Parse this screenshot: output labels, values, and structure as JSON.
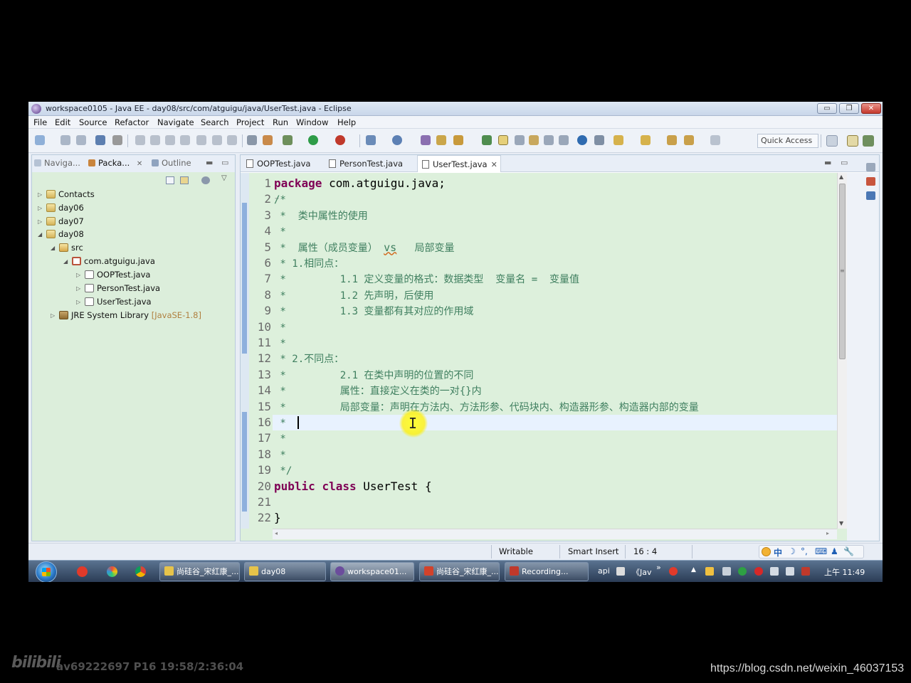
{
  "window": {
    "title": "workspace0105 - Java EE - day08/src/com/atguigu/java/UserTest.java - Eclipse",
    "controls": [
      "▭",
      "❐",
      "✕"
    ]
  },
  "menu": [
    "File",
    "Edit",
    "Source",
    "Refactor",
    "Navigate",
    "Search",
    "Project",
    "Run",
    "Window",
    "Help"
  ],
  "toolbar": {
    "quick_access": "Quick Access"
  },
  "left_panel": {
    "tabs": [
      {
        "label": "Naviga...",
        "active": false
      },
      {
        "label": "Packa...",
        "active": true,
        "close": "✕"
      },
      {
        "label": "Outline",
        "active": false
      }
    ],
    "tree": [
      {
        "label": "Contacts",
        "depth": 0,
        "arrow": "▷",
        "icon": "project-icon"
      },
      {
        "label": "day06",
        "depth": 0,
        "arrow": "▷",
        "icon": "project-icon"
      },
      {
        "label": "day07",
        "depth": 0,
        "arrow": "▷",
        "icon": "project-icon"
      },
      {
        "label": "day08",
        "depth": 0,
        "arrow": "◢",
        "icon": "project-icon"
      },
      {
        "label": "src",
        "depth": 1,
        "arrow": "◢",
        "icon": "source-folder-icon"
      },
      {
        "label": "com.atguigu.java",
        "depth": 2,
        "arrow": "◢",
        "icon": "package-icon"
      },
      {
        "label": "OOPTest.java",
        "depth": 3,
        "arrow": "▷",
        "icon": "java-file-icon"
      },
      {
        "label": "PersonTest.java",
        "depth": 3,
        "arrow": "▷",
        "icon": "java-file-icon"
      },
      {
        "label": "UserTest.java",
        "depth": 3,
        "arrow": "▷",
        "icon": "java-file-icon"
      },
      {
        "label": "JRE System Library",
        "depth": 1,
        "arrow": "▷",
        "icon": "library-icon",
        "decoration": "[JavaSE-1.8]"
      }
    ]
  },
  "editor": {
    "tabs": [
      {
        "label": "OOPTest.java",
        "active": false
      },
      {
        "label": "PersonTest.java",
        "active": false
      },
      {
        "label": "UserTest.java",
        "active": true,
        "close": "✕"
      }
    ],
    "line_numbers": [
      "1",
      "2",
      "3",
      "4",
      "5",
      "6",
      "7",
      "8",
      "9",
      "10",
      "11",
      "12",
      "13",
      "14",
      "15",
      "16",
      "17",
      "18",
      "19",
      "20",
      "21",
      "22"
    ],
    "lines": [
      {
        "kw": "package",
        "rest": " com.atguigu.java;"
      },
      {
        "comment": "/*"
      },
      {
        "comment": " *  类中属性的使用"
      },
      {
        "comment": " *"
      },
      {
        "comment_a": " *  属性（成员变量） ",
        "vs": "vs",
        "comment_b": "   局部变量"
      },
      {
        "comment": " * 1.相同点："
      },
      {
        "comment": " *         1.1 定义变量的格式：数据类型  变量名 =  变量值"
      },
      {
        "comment": " *         1.2 先声明，后使用"
      },
      {
        "comment": " *         1.3 变量都有其对应的作用域"
      },
      {
        "comment": " *"
      },
      {
        "comment": " *"
      },
      {
        "comment": " * 2.不同点："
      },
      {
        "comment": " *         2.1 在类中声明的位置的不同"
      },
      {
        "comment": " *         属性：直接定义在类的一对{}内"
      },
      {
        "comment": " *         局部变量：声明在方法内、方法形参、代码块内、构造器形参、构造器内部的变量"
      },
      {
        "comment": " * "
      },
      {
        "comment": " *"
      },
      {
        "comment": " *"
      },
      {
        "comment": " */"
      },
      {
        "kw": "public",
        "kw2": "class",
        "rest": " UserTest {"
      },
      {
        "plain": ""
      },
      {
        "plain": "}"
      }
    ],
    "folds": {
      "2": "−",
      "20": "−"
    },
    "current_line": 16,
    "cursor": {
      "glyph": "I"
    }
  },
  "status": {
    "writable": "Writable",
    "insert_mode": "Smart Insert",
    "position": "16 : 4",
    "ime": [
      "中",
      "☽",
      "°,",
      "⌨",
      "♟",
      "🔧"
    ]
  },
  "taskbar": {
    "tasks": [
      {
        "label": "尚硅谷_宋红康_...",
        "color": "#e6c34a"
      },
      {
        "label": "day08",
        "color": "#e6c34a"
      },
      {
        "label": "workspace01...",
        "color": "#6b4d9c",
        "active": true
      },
      {
        "label": "尚硅谷_宋红康_...",
        "color": "#d2422b"
      },
      {
        "label": "Recording...",
        "color": "#c0392b"
      }
    ],
    "tray_text": [
      "api",
      "《Jav",
      "»"
    ],
    "clock": "上午 11:49"
  },
  "overlay": {
    "bili_logo": "bilibili",
    "video_info": "av69222697 P16 19:58/2:36:04",
    "watermark": "https://blog.csdn.net/weixin_46037153"
  },
  "colors": {
    "editor_bg": "#ddf0dc",
    "keyword": "#7f0055",
    "comment": "#3f7f5f",
    "current_line": "#e8f2fe"
  }
}
